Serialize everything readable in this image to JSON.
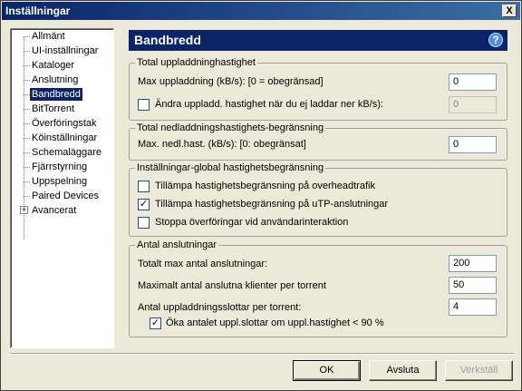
{
  "window": {
    "title": "Inställningar",
    "close_glyph": "X"
  },
  "tree": {
    "items": [
      {
        "label": "Allmänt"
      },
      {
        "label": "UI-inställningar"
      },
      {
        "label": "Kataloger"
      },
      {
        "label": "Anslutning"
      },
      {
        "label": "Bandbredd",
        "selected": true
      },
      {
        "label": "BitTorrent"
      },
      {
        "label": "Överföringstak"
      },
      {
        "label": "Köinställningar"
      },
      {
        "label": "Schemaläggare"
      },
      {
        "label": "Fjärrstyrning"
      },
      {
        "label": "Uppspelning"
      },
      {
        "label": "Paired Devices"
      },
      {
        "label": "Avancerat",
        "expandable": true
      }
    ],
    "expander_glyph": "+"
  },
  "header": {
    "title": "Bandbredd",
    "help_glyph": "?"
  },
  "upload_group": {
    "legend": "Total uppladdninghastighet",
    "max_label": "Max uppladdning (kB/s): [0 = obegränsad]",
    "max_value": "0",
    "alt_checkbox_label": "Ändra uppladd. hastighet när du ej laddar ner kB/s):",
    "alt_checked": false,
    "alt_value": "0"
  },
  "download_group": {
    "legend": "Total nedladdningshastighets-begränsning",
    "max_label": "Max. nedl.hast. (kB/s): [0: obegränsat]",
    "max_value": "0"
  },
  "global_group": {
    "legend": "Inställningar-global hastighetsbegränsning",
    "options": [
      {
        "label": "Tillämpa hastighetsbegränsning på overheadtrafik",
        "checked": false
      },
      {
        "label": "Tillämpa hastighetsbegränsning på uTP-anslutningar",
        "checked": true
      },
      {
        "label": "Stoppa överföringar vid användarinteraktion",
        "checked": false
      }
    ]
  },
  "connections_group": {
    "legend": "Antal anslutningar",
    "total_label": "Totalt max antal anslutningar:",
    "total_value": "200",
    "per_torrent_label": "Maximalt antal anslutna klienter per torrent",
    "per_torrent_value": "50",
    "slots_label": "Antal uppladdningsslottar per torrent:",
    "slots_value": "4",
    "boost_label": "Öka antalet uppl.slottar om uppl.hastighet < 90 %",
    "boost_checked": true
  },
  "buttons": {
    "ok": "OK",
    "cancel": "Avsluta",
    "apply": "Verkställ"
  },
  "check_glyph": "✓"
}
